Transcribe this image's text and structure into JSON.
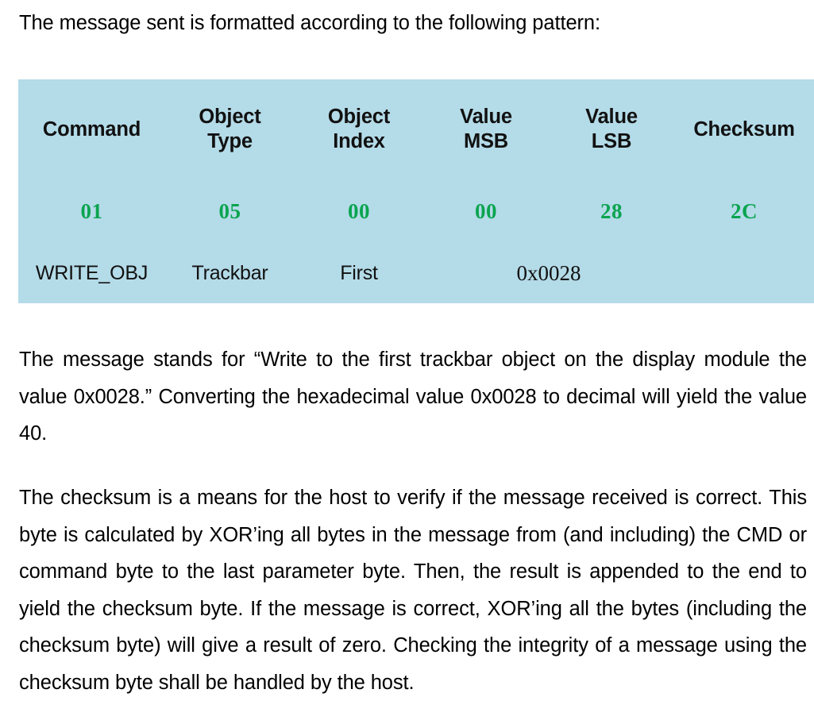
{
  "document": {
    "intro_line": "The message sent is formatted according to the following pattern:",
    "table": {
      "headers": [
        {
          "line1": "Command",
          "line2": ""
        },
        {
          "line1": "Object",
          "line2": "Type"
        },
        {
          "line1": "Object",
          "line2": "Index"
        },
        {
          "line1": "Value",
          "line2": "MSB"
        },
        {
          "line1": "Value",
          "line2": "LSB"
        },
        {
          "line1": "Checksum",
          "line2": ""
        }
      ],
      "hex_values": [
        "01",
        "05",
        "00",
        "00",
        "28",
        "2C"
      ],
      "labels": {
        "command": "WRITE_OBJ",
        "object_type": "Trackbar",
        "object_index": "First",
        "value_merged": "0x0028",
        "checksum": ""
      },
      "colors": {
        "background": "#b4dbe8",
        "hex_text": "#0aa44f",
        "text": "#111111"
      }
    },
    "paragraphs": [
      {
        "id": "para-1",
        "text": "The message stands for “Write to the first trackbar object on the display module the value 0x0028.” Converting the hexadecimal value 0x0028 to decimal will yield the value 40."
      },
      {
        "id": "para-2",
        "text": "The checksum is a means for the host to verify if the message received is correct. This byte is calculated by XOR’ing all bytes in the message from (and including) the CMD or command byte to the last parameter byte. Then, the result is appended to the end to yield the checksum byte. If the message is correct, XOR’ing all the bytes (including the checksum byte) will give a result of zero. Checking the integrity of a message using the checksum byte shall be handled by the host."
      }
    ]
  }
}
